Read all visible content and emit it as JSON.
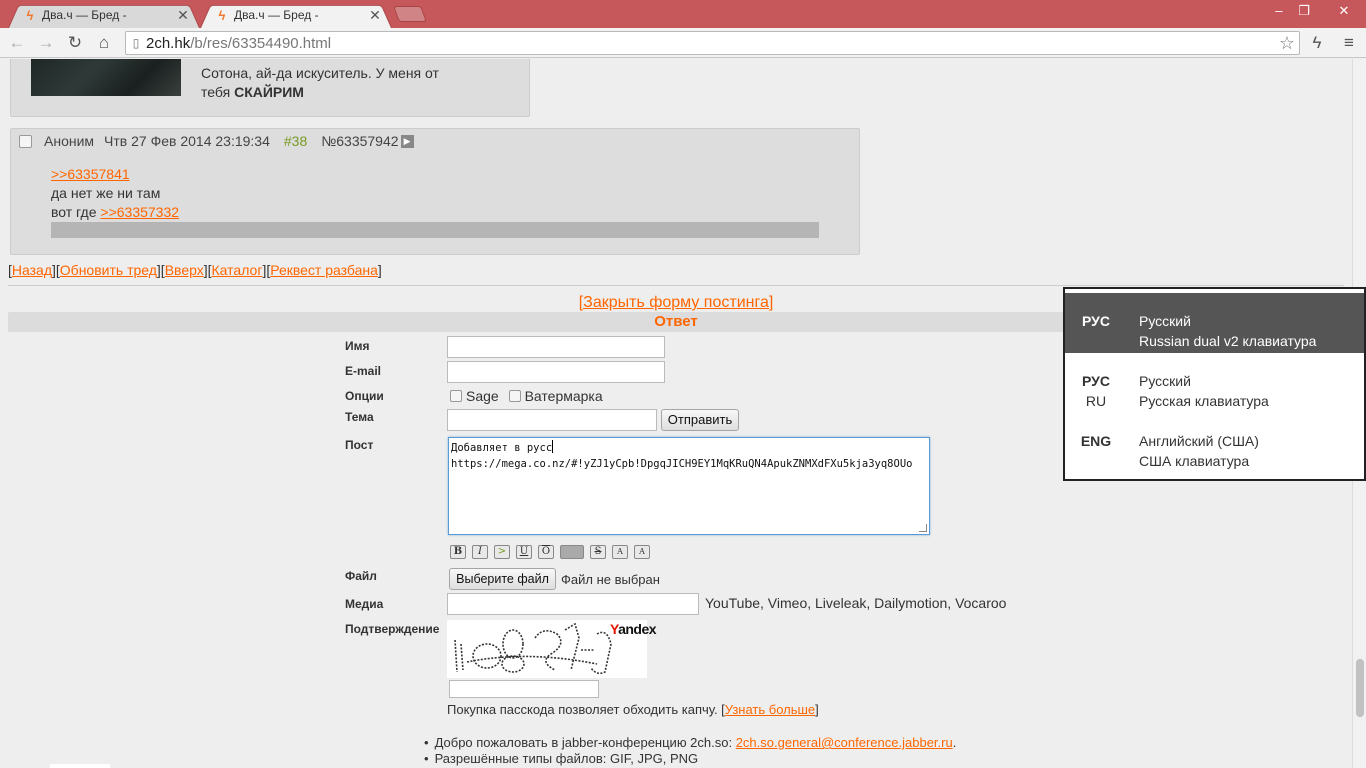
{
  "browser": {
    "tabs": [
      {
        "title": "Два.ч — Бред -",
        "active": false
      },
      {
        "title": "Два.ч — Бред -",
        "active": true
      }
    ],
    "url_host": "2ch.hk",
    "url_path": "/b/res/63354490.html",
    "window_controls": {
      "minimize": "‒",
      "restore": "❐",
      "close": "✕"
    }
  },
  "posts": {
    "first": {
      "text_line1": "Сотона, ай-да искуситель. У меня от",
      "text_line2_prefix": "тебя ",
      "text_line2_bold": "СКАЙРИМ"
    },
    "second": {
      "name": "Аноним",
      "date": "Чтв 27 Фев 2014 23:19:34",
      "index": "#38",
      "number": "№63357942",
      "reply_link": ">>63357841",
      "line1": "да нет же ни там",
      "line2_prefix": "вот где ",
      "line2_link": ">>63357332"
    }
  },
  "thread_nav": {
    "back": "Назад",
    "refresh": "Обновить тред",
    "top": "Вверх",
    "catalog": "Каталог",
    "request_ban": "Реквест разбана"
  },
  "form": {
    "close_link": "[Закрыть форму постинга]",
    "reply_header": "Ответ",
    "labels": {
      "name": "Имя",
      "email": "E-mail",
      "options": "Опции",
      "subject": "Тема",
      "post": "Пост",
      "file": "Файл",
      "media": "Медиа",
      "captcha": "Подтверждение"
    },
    "options": {
      "sage": "Sage",
      "watermark": "Ватермарка"
    },
    "submit": "Отправить",
    "post_text_line1": "Добавляет в русс",
    "post_text_rest": "https://mega.co.nz/#!yZJ1yCpb!DpgqJICH9EY1MqKRuQN4ApukZNMXdFXu5kja3yq8OUo",
    "markup_buttons": [
      "B",
      "I",
      ">",
      "U",
      "O",
      "",
      "S",
      "A",
      "A"
    ],
    "choose_file": "Выберите файл",
    "no_file": "Файл не выбран",
    "media_hint": "YouTube, Vimeo, Liveleak, Dailymotion, Vocaroo",
    "captcha_brand_y": "Y",
    "captcha_brand_rest": "andex",
    "captcha_text": "lo8oJL",
    "passcode_text": "Покупка пасскода позволяет обходить капчу. [",
    "passcode_link": "Узнать больше",
    "passcode_end": "]"
  },
  "rules": {
    "jabber_text": "Добро пожаловать в jabber-конференцию 2ch.so: ",
    "jabber_link": "2ch.so.general@conference.jabber.ru",
    "jabber_end": ".",
    "allowed_types": "Разрешённые типы файлов: GIF, JPG, PNG"
  },
  "language_popup": {
    "items": [
      {
        "code": "РУС",
        "sub": "",
        "name": "Русский",
        "layout": "Russian dual v2 клавиатура",
        "selected": true
      },
      {
        "code": "РУС",
        "sub": "RU",
        "name": "Русский",
        "layout": "Русская клавиатура",
        "selected": false
      },
      {
        "code": "ENG",
        "sub": "",
        "name": "Английский (США)",
        "layout": "США клавиатура",
        "selected": false
      }
    ]
  },
  "colors": {
    "accent": "#ff6600",
    "titlebar": "#c6575a",
    "post_bg": "#dddddd",
    "page_bg": "#eeeeee",
    "greentext": "#789922"
  }
}
